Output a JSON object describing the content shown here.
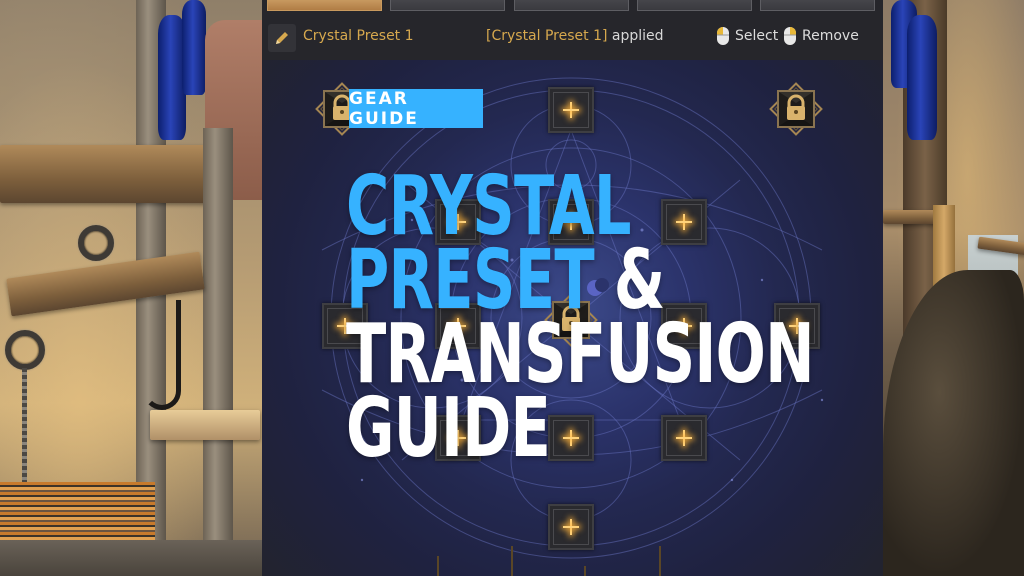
{
  "background": {
    "left_scene": "wooden-workshop-scene",
    "right_scene": "wooden-workshop-scene"
  },
  "panel": {
    "tabs": [
      {
        "label": "",
        "active": true
      },
      {
        "label": "",
        "active": false
      },
      {
        "label": "",
        "active": false
      },
      {
        "label": "",
        "active": false
      },
      {
        "label": "",
        "active": false
      }
    ],
    "rename_icon": "pencil-icon",
    "preset_name": "Crystal Preset 1",
    "applied_status": {
      "preset": "[Crystal Preset 1]",
      "suffix": " applied"
    },
    "hints": {
      "select_label": "Select",
      "select_icon": "mouse-left-click-icon",
      "remove_label": "Remove",
      "remove_icon": "mouse-right-click-icon"
    },
    "slots": {
      "empty_icon": "plus-icon",
      "locked_icon": "lock-icon",
      "empty_count": 13,
      "locked_count": 3
    }
  },
  "overlay": {
    "badge": "GEAR GUIDE",
    "title_lines": [
      {
        "text": "CRYSTAL",
        "color": "blue"
      },
      {
        "text": "PRESET",
        "color": "blue",
        "suffix": " &"
      },
      {
        "text": "TRANSFUSION",
        "color": "white"
      },
      {
        "text": "GUIDE",
        "color": "white"
      }
    ]
  },
  "colors": {
    "accent_gold": "#d6a84e",
    "accent_blue": "#36b2ff",
    "panel_bg": "#26262b",
    "active_tab": "#c0905a"
  }
}
